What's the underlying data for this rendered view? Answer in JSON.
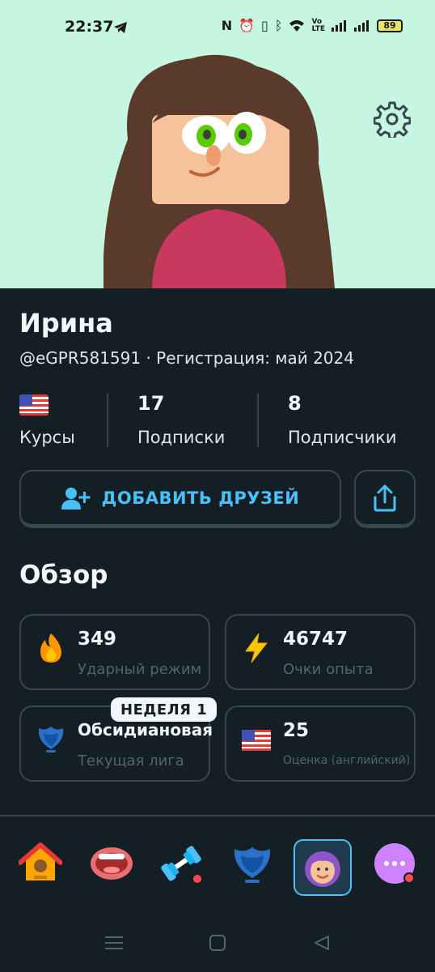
{
  "status_bar": {
    "time": "22:37",
    "battery": "89"
  },
  "profile": {
    "name": "Ирина",
    "handle": "@eGPR581591 · Регистрация: май 2024"
  },
  "stats": {
    "courses_label": "Курсы",
    "following_value": "17",
    "following_label": "Подписки",
    "followers_value": "8",
    "followers_label": "Подписчики"
  },
  "actions": {
    "add_friends_label": "ДОБАВИТЬ ДРУЗЕЙ"
  },
  "overview": {
    "title": "Обзор",
    "streak_value": "349",
    "streak_label": "Ударный режим",
    "xp_value": "46747",
    "xp_label": "Очки опыта",
    "league_value": "Обсидиановая",
    "league_label": "Текущая лига",
    "league_badge": "НЕДЕЛЯ 1",
    "score_value": "25",
    "score_label": "Оценка (английский)"
  },
  "colors": {
    "accent": "#49c0f8",
    "header_bg": "#c5f6e2",
    "page_bg": "#131f24",
    "border": "#37464f"
  },
  "icons": {
    "settings": "gear-icon",
    "add_friend": "add-person-icon",
    "share": "share-icon",
    "streak": "flame-icon",
    "xp": "lightning-icon",
    "league": "obsidian-shield-icon",
    "score": "us-flag-icon"
  }
}
